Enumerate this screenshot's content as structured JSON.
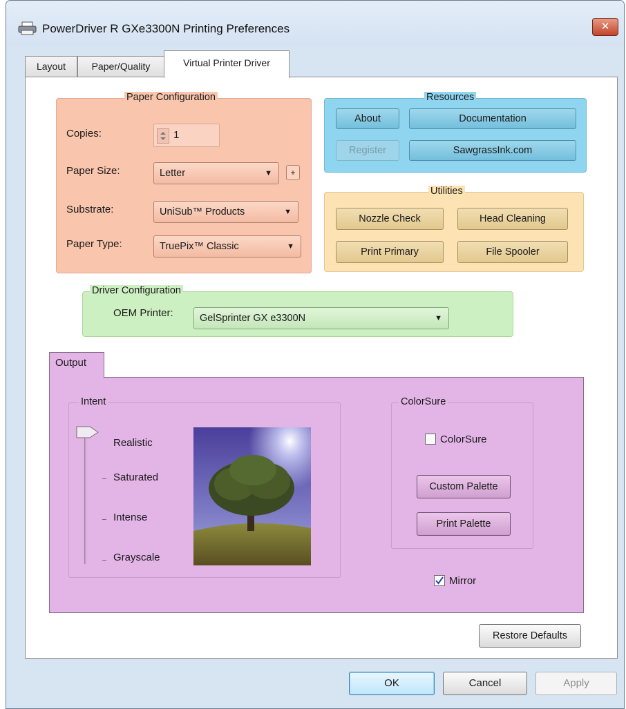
{
  "window": {
    "title": "PowerDriver R GXe3300N Printing Preferences",
    "close_label": "✕"
  },
  "tabs": [
    "Layout",
    "Paper/Quality",
    "Virtual Printer Driver"
  ],
  "paper_config": {
    "title": "Paper Configuration",
    "copies_label": "Copies:",
    "copies_value": "1",
    "paper_size_label": "Paper Size:",
    "paper_size_value": "Letter",
    "plus_label": "+",
    "substrate_label": "Substrate:",
    "substrate_value": "UniSub™ Products",
    "paper_type_label": "Paper Type:",
    "paper_type_value": "TruePix™ Classic"
  },
  "resources": {
    "title": "Resources",
    "about": "About",
    "documentation": "Documentation",
    "register": "Register",
    "website": "SawgrassInk.com"
  },
  "utilities": {
    "title": "Utilities",
    "nozzle_check": "Nozzle Check",
    "head_cleaning": "Head Cleaning",
    "print_primary": "Print Primary",
    "file_spooler": "File Spooler"
  },
  "driver_config": {
    "title": "Driver Configuration",
    "oem_label": "OEM Printer:",
    "oem_value": "GelSprinter GX e3300N"
  },
  "output": {
    "tab": "Output",
    "intent": {
      "title": "Intent",
      "options": [
        "Realistic",
        "Saturated",
        "Intense",
        "Grayscale"
      ],
      "selected": "Realistic"
    },
    "colorsure": {
      "title": "ColorSure",
      "checkbox_label": "ColorSure",
      "checked": false,
      "custom_palette": "Custom Palette",
      "print_palette": "Print Palette"
    },
    "mirror_label": "Mirror",
    "mirror_checked": true
  },
  "restore_defaults": "Restore Defaults",
  "footer": {
    "ok": "OK",
    "cancel": "Cancel",
    "apply": "Apply"
  },
  "colors": {
    "paper_panel": "#f9c5ad",
    "resources_panel": "#8fd5f0",
    "utilities_panel": "#fde3b3",
    "driver_panel": "#cdf0c3",
    "output_panel": "#e3b4e6"
  },
  "icons": {
    "printer": "printer-icon",
    "close": "close-icon",
    "dropdown": "chevron-down-icon",
    "spin": "spinner-icon"
  }
}
